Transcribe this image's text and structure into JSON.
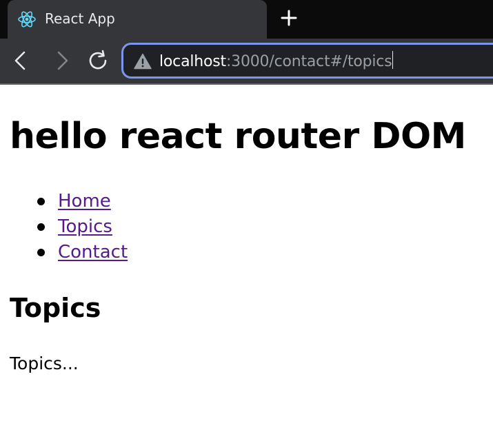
{
  "browser": {
    "tab": {
      "title": "React App",
      "favicon": "react-logo-icon"
    },
    "new_tab": "plus-icon",
    "nav": {
      "back": "back-arrow-icon",
      "forward": "forward-arrow-icon",
      "reload": "reload-icon"
    },
    "address_bar": {
      "security_icon": "not-secure-warning-icon",
      "url_host": "localhost",
      "url_rest": ":3000/contact#/topics"
    },
    "colors": {
      "tabstrip": "#0b0b0c",
      "toolbar": "#35363a",
      "omnibox_focus": "#7c96f0",
      "react_blue": "#61dafb",
      "link_visited": "#551a8b"
    }
  },
  "page": {
    "heading": "hello react router DOM",
    "nav_links": [
      {
        "label": "Home"
      },
      {
        "label": "Topics"
      },
      {
        "label": "Contact"
      }
    ],
    "section_title": "Topics",
    "section_body": "Topics..."
  }
}
